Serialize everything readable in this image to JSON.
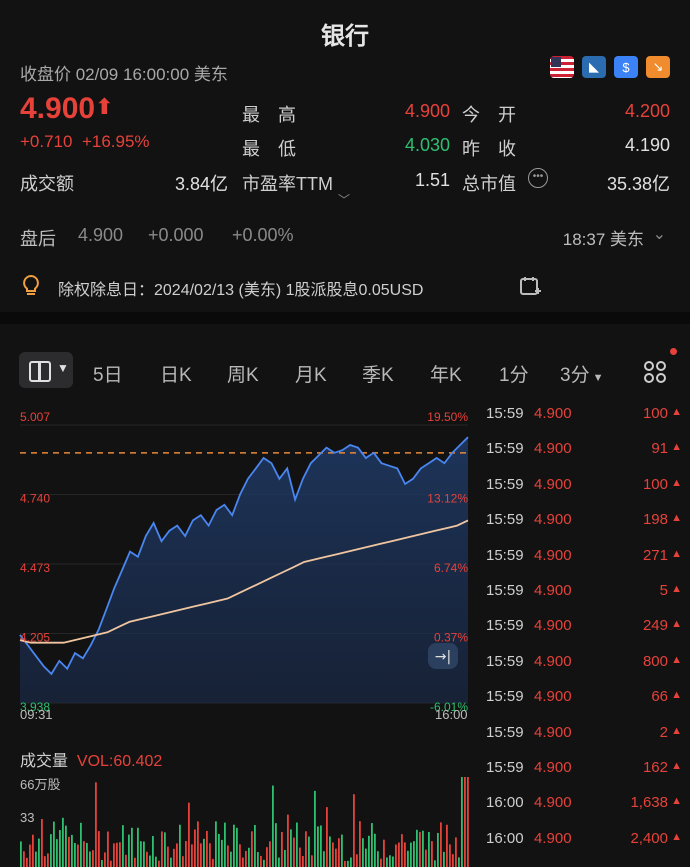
{
  "header": {
    "title": "银行",
    "close_label": "收盘价 02/09 16:00:00 美东"
  },
  "quote": {
    "price": "4.900",
    "change": "+0.710",
    "change_pct": "+16.95%",
    "high_label": "最　高",
    "high_value": "4.900",
    "open_label": "今　开",
    "open_value": "4.200",
    "low_label": "最　低",
    "low_value": "4.030",
    "prev_label": "昨　收",
    "prev_value": "4.190",
    "turnover_label": "成交额",
    "turnover_value": "3.84亿",
    "pe_label": "市盈率TTM",
    "pe_value": "1.51",
    "mcap_label": "总市值",
    "mcap_value": "35.38亿"
  },
  "after_hours": {
    "label": "盘后",
    "price": "4.900",
    "change": "+0.000",
    "pct": "+0.00%",
    "time": "18:37 美东"
  },
  "dividend": {
    "text": "除权除息日：2024/02/13 (美东) 1股派股息0.05USD"
  },
  "tabs": [
    "5日",
    "日K",
    "周K",
    "月K",
    "季K",
    "年K",
    "1分",
    "3分"
  ],
  "chart_data": {
    "type": "line",
    "y_ticks_left": [
      "5.007",
      "4.740",
      "4.473",
      "4.205",
      "3.938"
    ],
    "y_ticks_right": [
      "19.50%",
      "13.12%",
      "6.74%",
      "0.37%",
      "-6.01%"
    ],
    "x_labels": [
      "09:31",
      "16:00"
    ],
    "ylim": [
      3.938,
      5.007
    ],
    "series": [
      {
        "values": [
          4.2,
          4.16,
          4.12,
          4.08,
          4.05,
          4.1,
          4.07,
          4.13,
          4.11,
          4.16,
          4.22,
          4.3,
          4.38,
          4.45,
          4.52,
          4.5,
          4.58,
          4.63,
          4.56,
          4.6,
          4.62,
          4.58,
          4.64,
          4.66,
          4.62,
          4.68,
          4.7,
          4.66,
          4.74,
          4.8,
          4.84,
          4.88,
          4.86,
          4.8,
          4.84,
          4.72,
          4.8,
          4.86,
          4.89,
          4.92,
          4.9,
          4.91,
          4.93,
          4.92,
          4.88,
          4.9,
          4.86,
          4.85,
          4.84,
          4.78,
          4.8,
          4.84,
          4.86,
          4.88,
          4.86,
          4.9,
          4.93,
          4.96
        ]
      },
      {
        "values": [
          4.18,
          4.17,
          4.17,
          4.17,
          4.17,
          4.18,
          4.19,
          4.2,
          4.21,
          4.23,
          4.25,
          4.26,
          4.27,
          4.28,
          4.29,
          4.3,
          4.31,
          4.32,
          4.33,
          4.34,
          4.36,
          4.38,
          4.4,
          4.42,
          4.44,
          4.46,
          4.48,
          4.49,
          4.5,
          4.51,
          4.52,
          4.53,
          4.54,
          4.55,
          4.56,
          4.57,
          4.58,
          4.59,
          4.6,
          4.61,
          4.62,
          4.64
        ]
      }
    ],
    "reference_line": 4.9
  },
  "volume": {
    "label": "成交量",
    "vol": "VOL:60.402",
    "tick_top": "66万股",
    "tick_mid": "33"
  },
  "trades": [
    {
      "t": "15:59",
      "p": "4.900",
      "v": "100"
    },
    {
      "t": "15:59",
      "p": "4.900",
      "v": "91"
    },
    {
      "t": "15:59",
      "p": "4.900",
      "v": "100"
    },
    {
      "t": "15:59",
      "p": "4.900",
      "v": "198"
    },
    {
      "t": "15:59",
      "p": "4.900",
      "v": "271"
    },
    {
      "t": "15:59",
      "p": "4.900",
      "v": "5"
    },
    {
      "t": "15:59",
      "p": "4.900",
      "v": "249"
    },
    {
      "t": "15:59",
      "p": "4.900",
      "v": "800"
    },
    {
      "t": "15:59",
      "p": "4.900",
      "v": "66"
    },
    {
      "t": "15:59",
      "p": "4.900",
      "v": "2"
    },
    {
      "t": "15:59",
      "p": "4.900",
      "v": "162"
    },
    {
      "t": "16:00",
      "p": "4.900",
      "v": "1,638"
    },
    {
      "t": "16:00",
      "p": "4.900",
      "v": "2,400"
    }
  ]
}
